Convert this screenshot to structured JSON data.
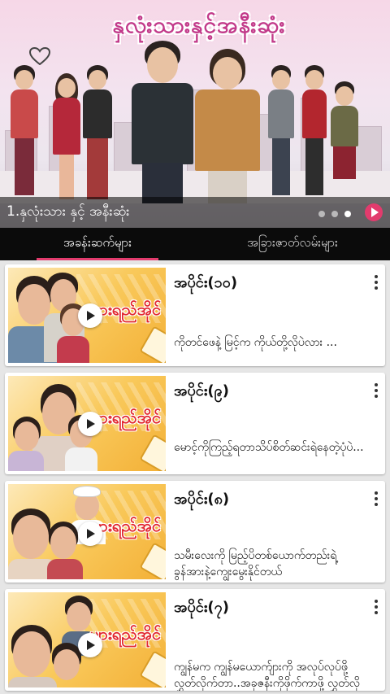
{
  "banner": {
    "title": "နှလုံးသားနှင့်အနီးဆုံး",
    "caption": "1.နှလုံးသား နှင့် အနီးဆုံး",
    "dots": 3,
    "active_dot": 2
  },
  "tabs": [
    {
      "label": "အခန်းဆက်များ",
      "active": true
    },
    {
      "label": "အခြားဇာတ်လမ်းများ",
      "active": false
    }
  ],
  "thumb_brand": "ပျားရည်အိုင်",
  "episodes": [
    {
      "title": "အပိုင်း(၁၀)",
      "desc": "ကိုတင်ဖေနဲ့ မြင့်က ကိုယ်တို့လိုပဲလား ..."
    },
    {
      "title": "အပိုင်း(၉)",
      "desc": "မောင့်ကိုကြည့်ရတာသိပ်စိတ်ဆင်းရဲနေတဲ့ပုံပဲ..."
    },
    {
      "title": "အပိုင်း(၈)",
      "desc": "သမီးလေးကို မြည့်ပိတစ်ယောက်တည်းရဲ့ ခွန်အားနဲ့ကျွေးမွေးနိုင်တယ်"
    },
    {
      "title": "အပိုင်း(၇)",
      "desc": "ကျွန်မက ကျွန်မယောက်ျားကို အလုပ်လုပ်ဖို့ လွှတ်လိုက်တာ..အခုဇနီးကိုဖိုက်ကာဖို့ လွှတ်လို"
    }
  ],
  "colors": {
    "tab_bar": "#0b0b0b",
    "tab_indicator": "#e23b6d",
    "banner_title": "#c23a8a",
    "thumb_bg": "#f9c95b"
  }
}
